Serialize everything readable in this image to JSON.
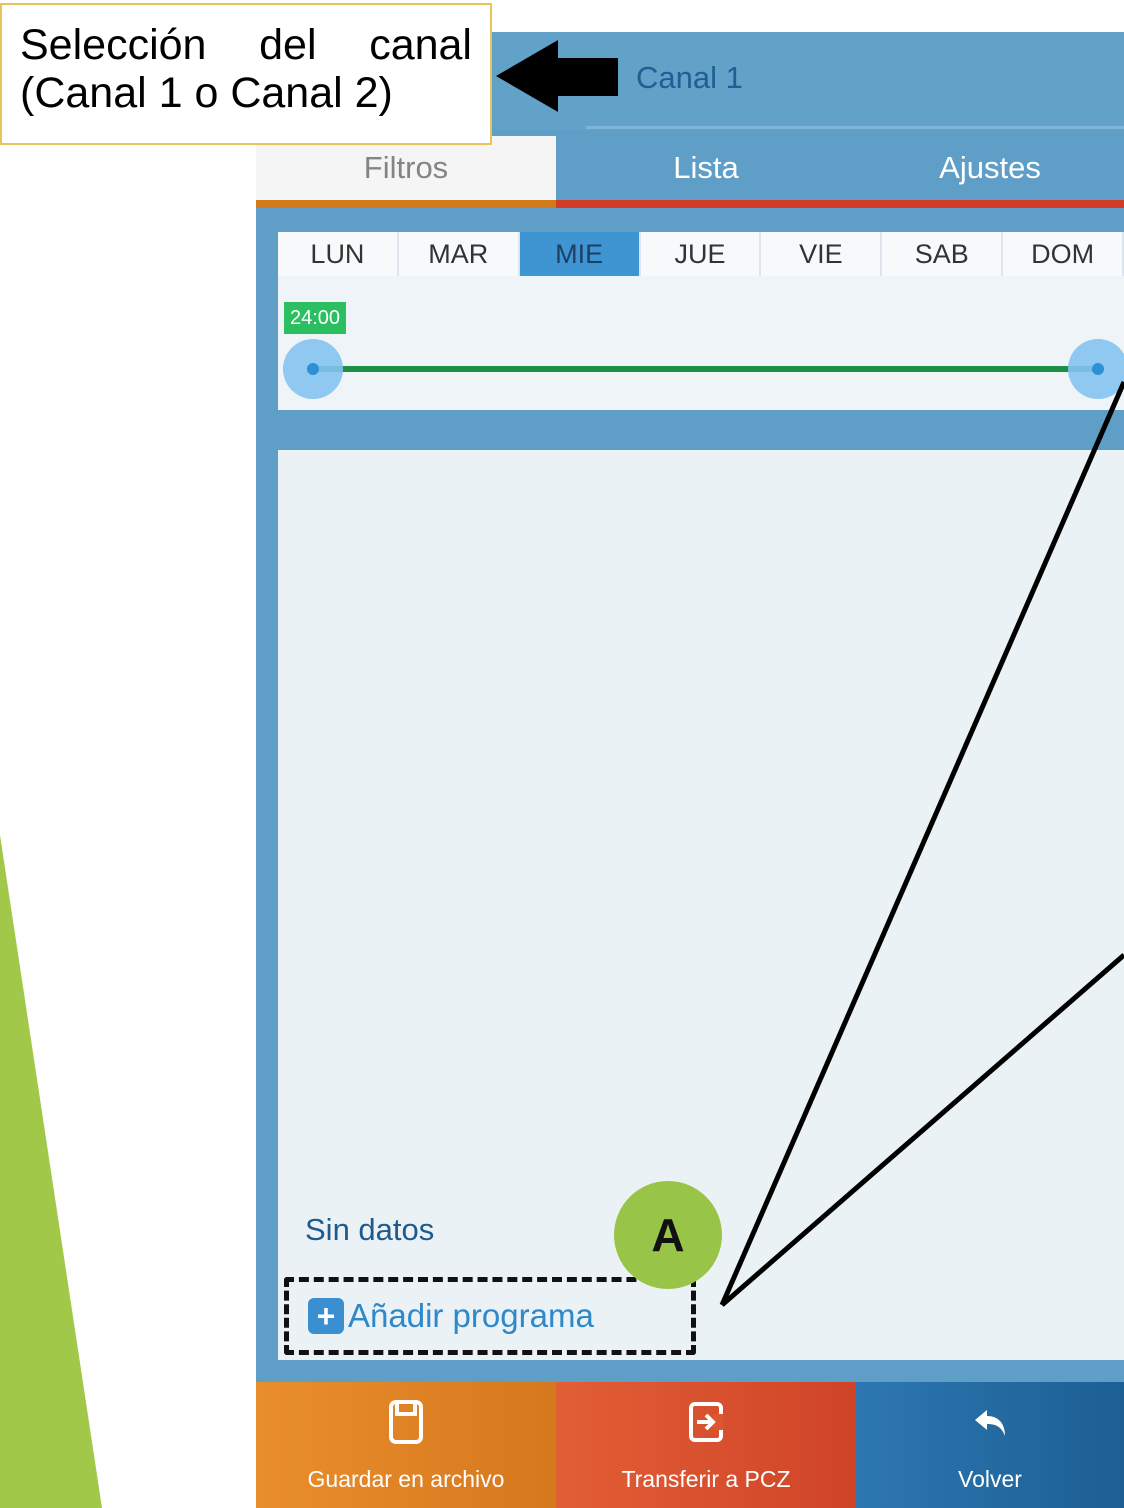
{
  "annotation": {
    "line1_word1": "Selección",
    "line1_word2": "del",
    "line1_word3": "canal",
    "line2": "(Canal 1 o Canal 2)"
  },
  "header": {
    "channel": "Canal 1"
  },
  "tabs": [
    {
      "label": "Filtros",
      "active": true
    },
    {
      "label": "Lista",
      "active": false
    },
    {
      "label": "Ajustes",
      "active": false
    }
  ],
  "days": [
    "LUN",
    "MAR",
    "MIE",
    "JUE",
    "VIE",
    "SAB",
    "DOM"
  ],
  "selected_day": "MIE",
  "timeline": {
    "time_badge": "24:00"
  },
  "content": {
    "empty_message": "Sin datos",
    "add_program_label": "Añadir programa"
  },
  "callout": {
    "marker": "A"
  },
  "bottom_bar": {
    "save_label": "Guardar en archivo",
    "transfer_label": "Transferir a PCZ",
    "back_label": "Volver"
  },
  "colors": {
    "accent_green": "#98c447",
    "save": "#e98e2c",
    "transfer": "#e25e35",
    "back": "#2d77b1"
  },
  "icons": {
    "save": "floppy-disk-icon",
    "transfer": "export-arrow-icon",
    "back": "reply-arrow-icon",
    "add": "plus-icon"
  }
}
